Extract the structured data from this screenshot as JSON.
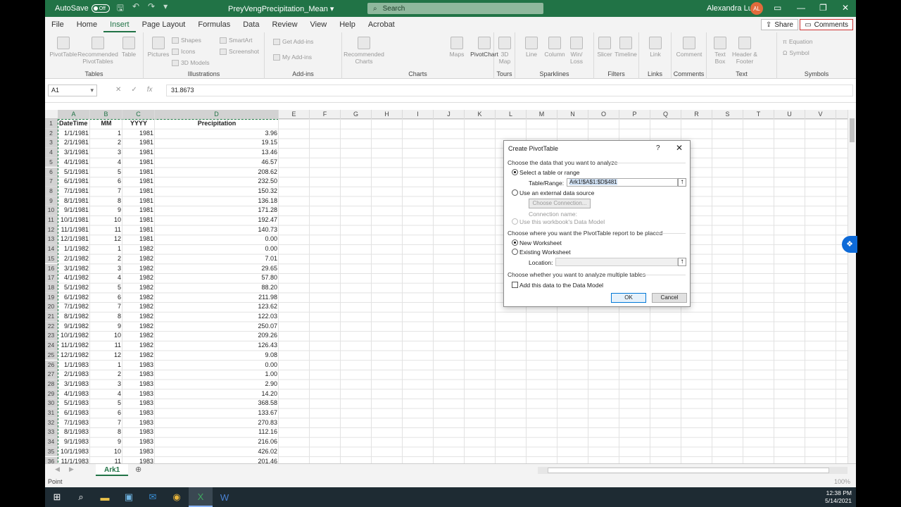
{
  "titlebar": {
    "autosave_label": "AutoSave",
    "autosave_state": "Off",
    "doc_title": "PreyVengPrecipitation_Mean",
    "search_placeholder": "Search",
    "user_name": "Alexandra Lutz",
    "user_initials": "AL"
  },
  "menu": {
    "tabs": [
      "File",
      "Home",
      "Insert",
      "Page Layout",
      "Formulas",
      "Data",
      "Review",
      "View",
      "Help",
      "Acrobat"
    ],
    "active": "Insert",
    "share_label": "Share",
    "comments_label": "Comments"
  },
  "ribbon": {
    "tables": {
      "label": "Tables",
      "pivottable": "PivotTable",
      "recommended": "Recommended PivotTables",
      "table": "Table"
    },
    "illustrations": {
      "label": "Illustrations",
      "pictures": "Pictures",
      "shapes": "Shapes",
      "icons": "Icons",
      "models": "3D Models",
      "smartart": "SmartArt",
      "screenshot": "Screenshot"
    },
    "addins": {
      "label": "Add-ins",
      "get": "Get Add-ins",
      "my": "My Add-ins"
    },
    "charts": {
      "label": "Charts",
      "recommended": "Recommended Charts",
      "maps": "Maps",
      "pivotchart": "PivotChart"
    },
    "tours": {
      "label": "Tours",
      "map3d": "3D Map"
    },
    "sparklines": {
      "label": "Sparklines",
      "line": "Line",
      "column": "Column",
      "winloss": "Win/ Loss"
    },
    "filters": {
      "label": "Filters",
      "slicer": "Slicer",
      "timeline": "Timeline"
    },
    "links": {
      "label": "Links",
      "link": "Link"
    },
    "comments": {
      "label": "Comments",
      "comment": "Comment"
    },
    "text": {
      "label": "Text",
      "textbox": "Text Box",
      "header": "Header & Footer"
    },
    "symbols": {
      "label": "Symbols",
      "equation": "Equation",
      "symbol": "Symbol"
    }
  },
  "formula_bar": {
    "name_box": "A1",
    "value": "31.8673"
  },
  "columns": [
    "A",
    "B",
    "C",
    "D",
    "E",
    "F",
    "G",
    "H",
    "I",
    "J",
    "K",
    "L",
    "M",
    "N",
    "O",
    "P",
    "Q",
    "R",
    "S",
    "T",
    "U",
    "V"
  ],
  "headers": [
    "DateTime",
    "MM",
    "YYYY",
    "Precipitation"
  ],
  "rows": [
    [
      "1/1/1981",
      "1",
      "1981",
      "3.96"
    ],
    [
      "2/1/1981",
      "2",
      "1981",
      "19.15"
    ],
    [
      "3/1/1981",
      "3",
      "1981",
      "13.46"
    ],
    [
      "4/1/1981",
      "4",
      "1981",
      "46.57"
    ],
    [
      "5/1/1981",
      "5",
      "1981",
      "208.62"
    ],
    [
      "6/1/1981",
      "6",
      "1981",
      "232.50"
    ],
    [
      "7/1/1981",
      "7",
      "1981",
      "150.32"
    ],
    [
      "8/1/1981",
      "8",
      "1981",
      "136.18"
    ],
    [
      "9/1/1981",
      "9",
      "1981",
      "171.28"
    ],
    [
      "10/1/1981",
      "10",
      "1981",
      "192.47"
    ],
    [
      "11/1/1981",
      "11",
      "1981",
      "140.73"
    ],
    [
      "12/1/1981",
      "12",
      "1981",
      "0.00"
    ],
    [
      "1/1/1982",
      "1",
      "1982",
      "0.00"
    ],
    [
      "2/1/1982",
      "2",
      "1982",
      "7.01"
    ],
    [
      "3/1/1982",
      "3",
      "1982",
      "29.65"
    ],
    [
      "4/1/1982",
      "4",
      "1982",
      "57.80"
    ],
    [
      "5/1/1982",
      "5",
      "1982",
      "88.20"
    ],
    [
      "6/1/1982",
      "6",
      "1982",
      "211.98"
    ],
    [
      "7/1/1982",
      "7",
      "1982",
      "123.62"
    ],
    [
      "8/1/1982",
      "8",
      "1982",
      "122.03"
    ],
    [
      "9/1/1982",
      "9",
      "1982",
      "250.07"
    ],
    [
      "10/1/1982",
      "10",
      "1982",
      "209.26"
    ],
    [
      "11/1/1982",
      "11",
      "1982",
      "126.43"
    ],
    [
      "12/1/1982",
      "12",
      "1982",
      "9.08"
    ],
    [
      "1/1/1983",
      "1",
      "1983",
      "0.00"
    ],
    [
      "2/1/1983",
      "2",
      "1983",
      "1.00"
    ],
    [
      "3/1/1983",
      "3",
      "1983",
      "2.90"
    ],
    [
      "4/1/1983",
      "4",
      "1983",
      "14.20"
    ],
    [
      "5/1/1983",
      "5",
      "1983",
      "368.58"
    ],
    [
      "6/1/1983",
      "6",
      "1983",
      "133.67"
    ],
    [
      "7/1/1983",
      "7",
      "1983",
      "270.83"
    ],
    [
      "8/1/1983",
      "8",
      "1983",
      "112.16"
    ],
    [
      "9/1/1983",
      "9",
      "1983",
      "216.06"
    ],
    [
      "10/1/1983",
      "10",
      "1983",
      "426.02"
    ],
    [
      "11/1/1983",
      "11",
      "1983",
      "201.46"
    ]
  ],
  "sheet": {
    "tab": "Ark1"
  },
  "status": {
    "mode": "Point",
    "zoom": "100%"
  },
  "dialog": {
    "title": "Create PivotTable",
    "section1": "Choose the data that you want to analyze",
    "opt_table": "Select a table or range",
    "range_label": "Table/Range:",
    "range_value": "Ark1!$A$1:$D$481",
    "opt_external": "Use an external data source",
    "choose_connection": "Choose Connection...",
    "connection_name": "Connection name:",
    "opt_model": "Use this workbook's Data Model",
    "section2": "Choose where you want the PivotTable report to be placed",
    "opt_new": "New Worksheet",
    "opt_existing": "Existing Worksheet",
    "location_label": "Location:",
    "section3": "Choose whether you want to analyze multiple tables",
    "add_model": "Add this data to the Data Model",
    "ok": "OK",
    "cancel": "Cancel"
  },
  "taskbar": {
    "time": "12:38 PM",
    "date": "5/14/2021"
  }
}
